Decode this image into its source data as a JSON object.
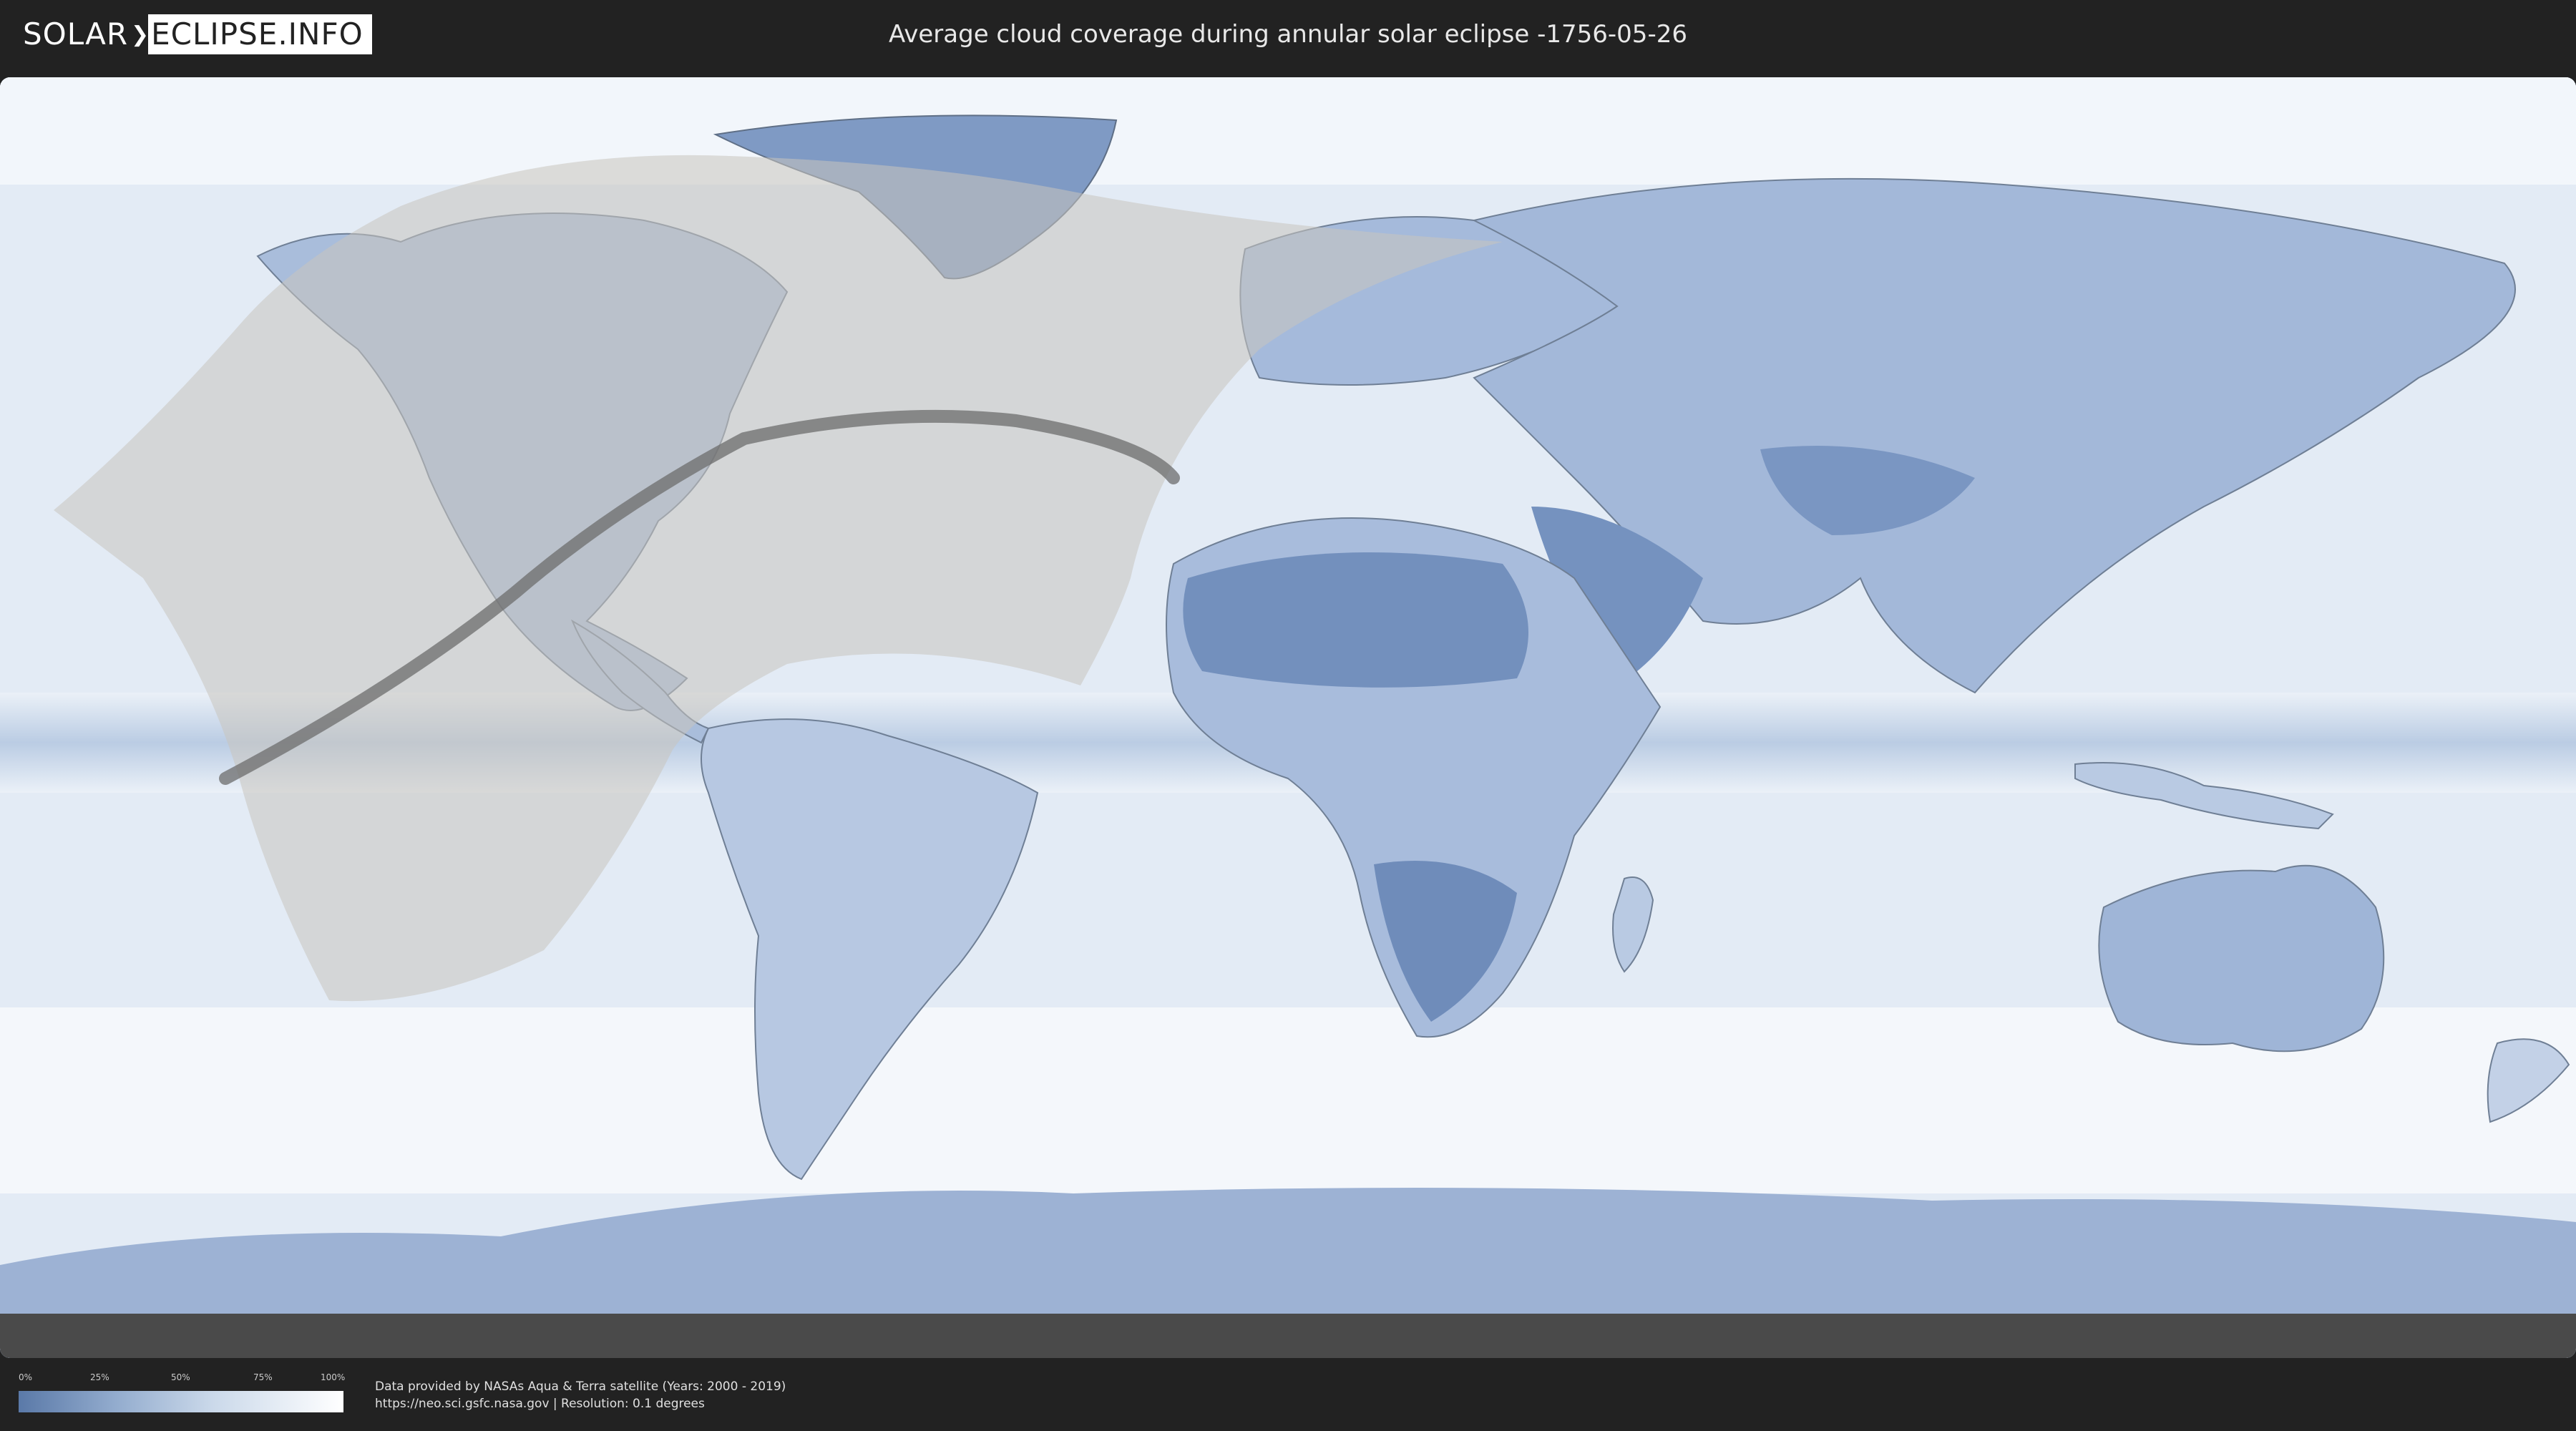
{
  "header": {
    "logo_left": "SOLAR",
    "logo_right": "ECLIPSE.INFO",
    "title": "Average cloud coverage during annular solar eclipse -1756-05-26"
  },
  "legend": {
    "ticks": [
      "0%",
      "25%",
      "50%",
      "75%",
      "100%"
    ],
    "colors": {
      "low": "#5a79a8",
      "high": "#ffffff"
    }
  },
  "credits": {
    "line1": "Data provided by NASAs Aqua & Terra satellite (Years: 2000 - 2019)",
    "line2": "https://neo.sci.gsfc.nasa.gov | Resolution: 0.1 degrees"
  },
  "colors": {
    "ocean_cloud": "#dde8f3",
    "land_dark": "#7d98c2",
    "eclipse_zone": "#c8c4be",
    "central_path": "#6c6c6c",
    "background": "#222222"
  }
}
